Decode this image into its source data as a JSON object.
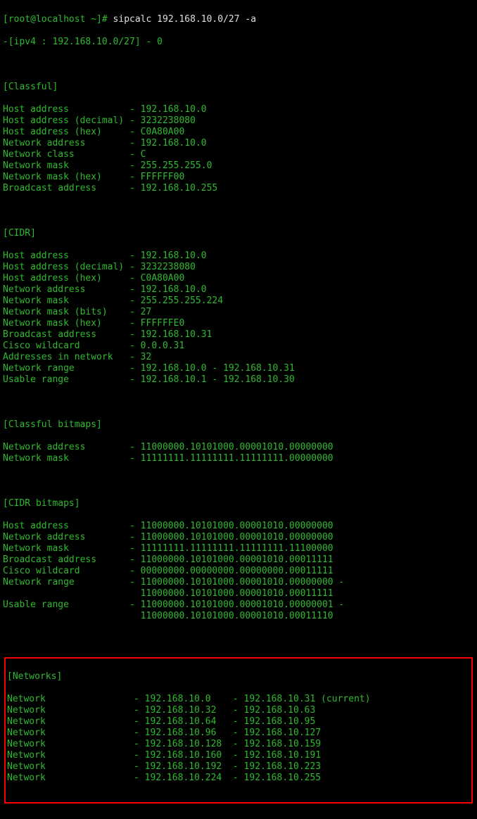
{
  "prompt": {
    "user_host": "[root@localhost ~]#",
    "command": "sipcalc 192.168.10.0/27 -a"
  },
  "header": "-[ipv4 : 192.168.10.0/27] - 0",
  "sections": {
    "classful": {
      "title": "[Classful]",
      "rows": [
        {
          "label": "Host address",
          "value": "192.168.10.0"
        },
        {
          "label": "Host address (decimal)",
          "value": "3232238080"
        },
        {
          "label": "Host address (hex)",
          "value": "C0A80A00"
        },
        {
          "label": "Network address",
          "value": "192.168.10.0"
        },
        {
          "label": "Network class",
          "value": "C"
        },
        {
          "label": "Network mask",
          "value": "255.255.255.0"
        },
        {
          "label": "Network mask (hex)",
          "value": "FFFFFF00"
        },
        {
          "label": "Broadcast address",
          "value": "192.168.10.255"
        }
      ]
    },
    "cidr": {
      "title": "[CIDR]",
      "rows": [
        {
          "label": "Host address",
          "value": "192.168.10.0"
        },
        {
          "label": "Host address (decimal)",
          "value": "3232238080"
        },
        {
          "label": "Host address (hex)",
          "value": "C0A80A00"
        },
        {
          "label": "Network address",
          "value": "192.168.10.0"
        },
        {
          "label": "Network mask",
          "value": "255.255.255.224"
        },
        {
          "label": "Network mask (bits)",
          "value": "27"
        },
        {
          "label": "Network mask (hex)",
          "value": "FFFFFFE0"
        },
        {
          "label": "Broadcast address",
          "value": "192.168.10.31"
        },
        {
          "label": "Cisco wildcard",
          "value": "0.0.0.31"
        },
        {
          "label": "Addresses in network",
          "value": "32"
        },
        {
          "label": "Network range",
          "value": "192.168.10.0 - 192.168.10.31"
        },
        {
          "label": "Usable range",
          "value": "192.168.10.1 - 192.168.10.30"
        }
      ]
    },
    "classful_bitmaps": {
      "title": "[Classful bitmaps]",
      "rows": [
        {
          "label": "Network address",
          "value": "11000000.10101000.00001010.00000000"
        },
        {
          "label": "Network mask",
          "value": "11111111.11111111.11111111.00000000"
        }
      ]
    },
    "cidr_bitmaps": {
      "title": "[CIDR bitmaps]",
      "rows": [
        {
          "label": "Host address",
          "value": "11000000.10101000.00001010.00000000"
        },
        {
          "label": "Network address",
          "value": "11000000.10101000.00001010.00000000"
        },
        {
          "label": "Network mask",
          "value": "11111111.11111111.11111111.11100000"
        },
        {
          "label": "Broadcast address",
          "value": "11000000.10101000.00001010.00011111"
        },
        {
          "label": "Cisco wildcard",
          "value": "00000000.00000000.00000000.00011111"
        },
        {
          "label": "Network range",
          "value": "11000000.10101000.00001010.00000000 -"
        },
        {
          "label": "",
          "value": "11000000.10101000.00001010.00011111"
        },
        {
          "label": "Usable range",
          "value": "11000000.10101000.00001010.00000001 -"
        },
        {
          "label": "",
          "value": "11000000.10101000.00001010.00011110"
        }
      ]
    },
    "networks": {
      "title": "[Networks]",
      "rows": [
        {
          "label": "Network",
          "start": "192.168.10.0",
          "end": "192.168.10.31 (current)"
        },
        {
          "label": "Network",
          "start": "192.168.10.32",
          "end": "192.168.10.63"
        },
        {
          "label": "Network",
          "start": "192.168.10.64",
          "end": "192.168.10.95"
        },
        {
          "label": "Network",
          "start": "192.168.10.96",
          "end": "192.168.10.127"
        },
        {
          "label": "Network",
          "start": "192.168.10.128",
          "end": "192.168.10.159"
        },
        {
          "label": "Network",
          "start": "192.168.10.160",
          "end": "192.168.10.191"
        },
        {
          "label": "Network",
          "start": "192.168.10.192",
          "end": "192.168.10.223"
        },
        {
          "label": "Network",
          "start": "192.168.10.224",
          "end": "192.168.10.255"
        }
      ]
    }
  }
}
